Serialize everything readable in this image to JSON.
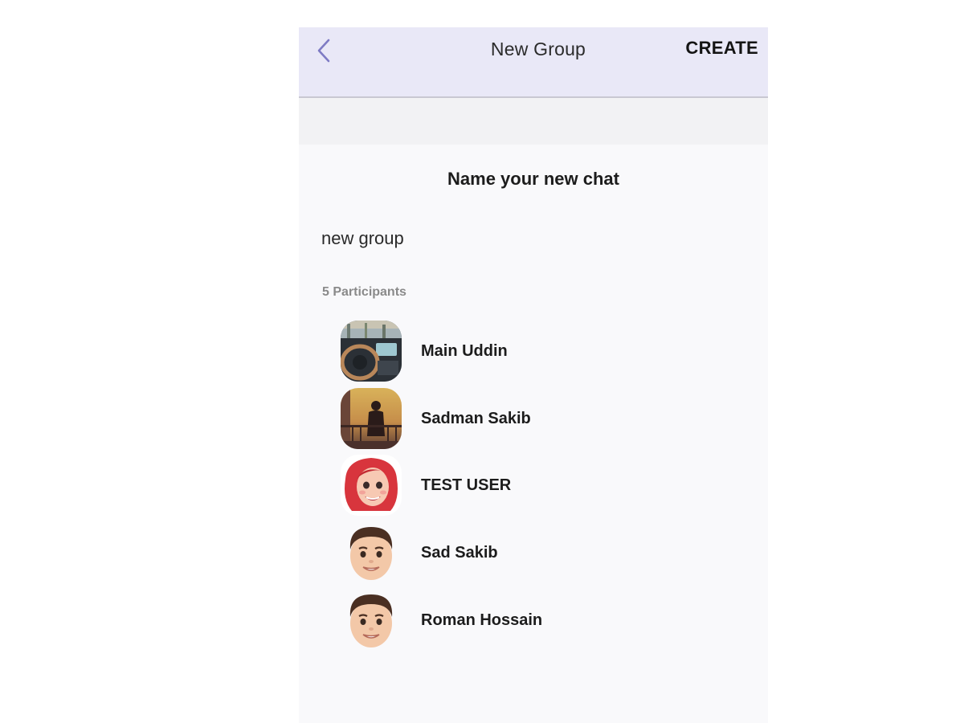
{
  "appbar": {
    "title": "New Group",
    "create_label": "CREATE",
    "back_icon": "chevron-left-icon",
    "accent_color": "#7e7bc4"
  },
  "form": {
    "heading": "Name your new chat",
    "chat_name_value": "new group"
  },
  "participants": {
    "count_label": "5 Participants",
    "items": [
      {
        "name": "Main Uddin",
        "avatar": "car-dashboard-photo"
      },
      {
        "name": "Sadman Sakib",
        "avatar": "silhouette-sunset-photo"
      },
      {
        "name": "TEST USER",
        "avatar": "red-hair-woman-emoji"
      },
      {
        "name": "Sad Sakib",
        "avatar": "man-emoji"
      },
      {
        "name": "Roman Hossain",
        "avatar": "man-emoji"
      }
    ]
  }
}
